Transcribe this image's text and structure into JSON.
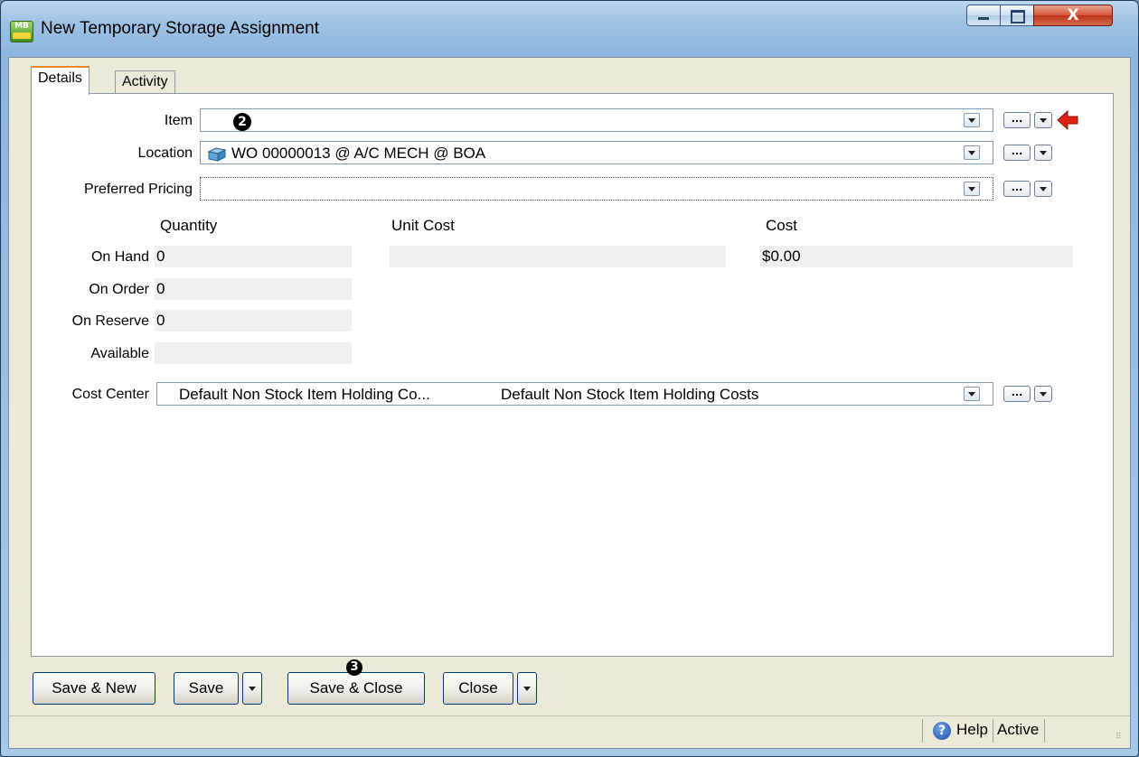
{
  "window": {
    "title": "New Temporary Storage Assignment",
    "app_icon_text": "MB",
    "close_glyph": "X"
  },
  "tabs": [
    {
      "label": "Details"
    },
    {
      "label": "Activity"
    }
  ],
  "fields": {
    "item": {
      "label": "Item",
      "value": ""
    },
    "location": {
      "label": "Location",
      "value": "WO 00000013 @ A/C MECH @ BOA"
    },
    "preferred_pricing": {
      "label": "Preferred Pricing",
      "value": ""
    },
    "cost_center": {
      "label": "Cost Center",
      "code": "Default  Non  Stock  Item  Holding Co...",
      "description": "Default Non Stock Item Holding Costs"
    }
  },
  "columns": {
    "quantity": "Quantity",
    "unit_cost": "Unit Cost",
    "cost": "Cost"
  },
  "rows": [
    {
      "label": "On Hand",
      "quantity": "0",
      "unit_cost": "",
      "cost": "$0.00"
    },
    {
      "label": "On Order",
      "quantity": "0"
    },
    {
      "label": "On Reserve",
      "quantity": "0"
    },
    {
      "label": "Available",
      "quantity": ""
    }
  ],
  "more_button": "...",
  "buttons": {
    "save_new": "Save & New",
    "save": "Save",
    "save_close": "Save & Close",
    "close": "Close"
  },
  "markers": {
    "item": "2",
    "save_close": "3"
  },
  "status": {
    "help": "Help",
    "state": "Active"
  },
  "colors": {
    "accent_arrow": "#e02010",
    "tab_highlight": "#e68b2c"
  }
}
